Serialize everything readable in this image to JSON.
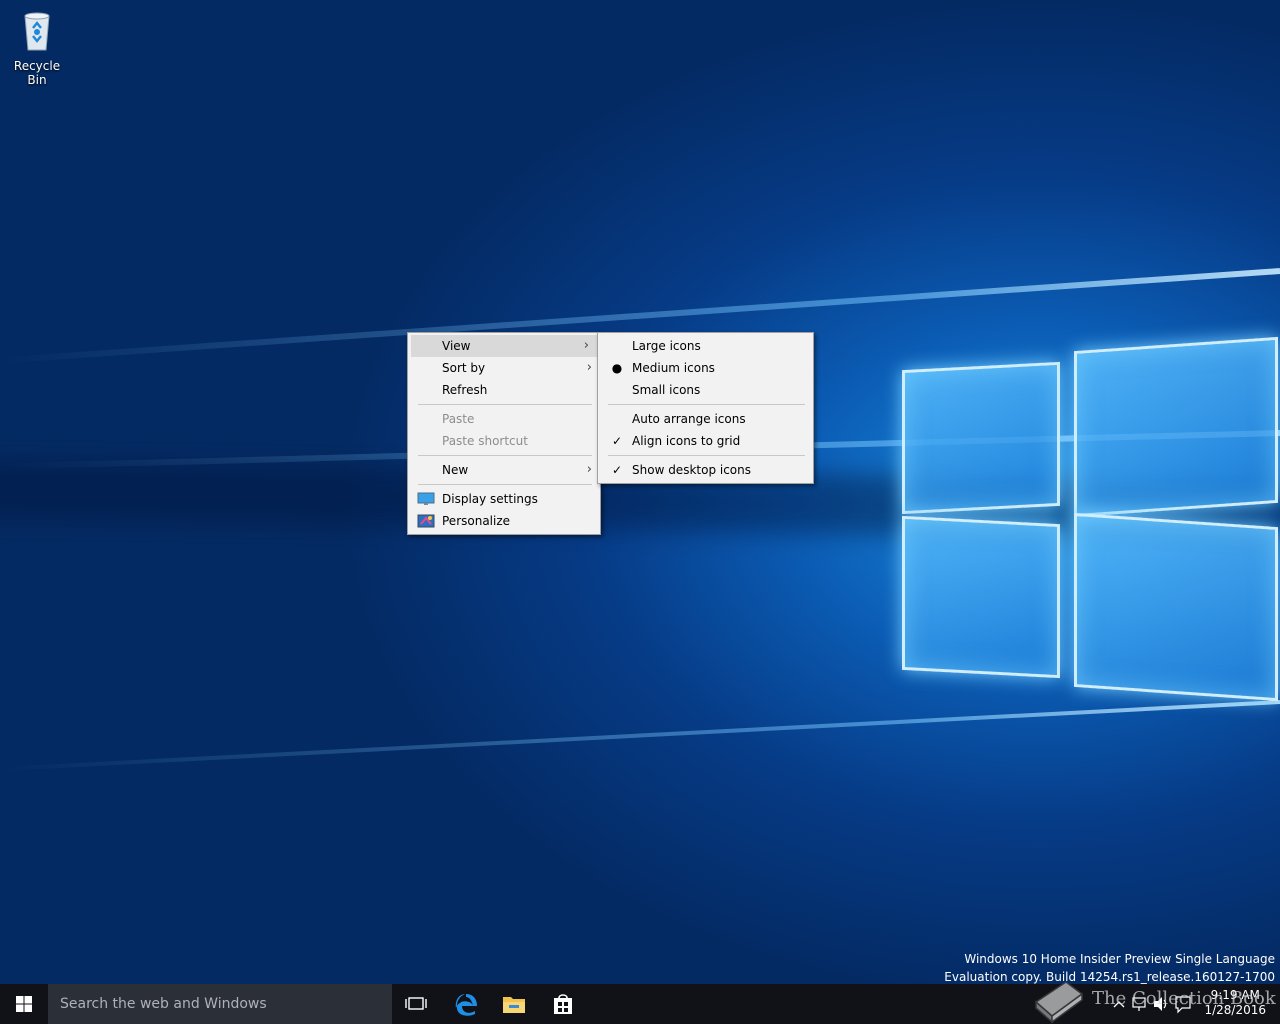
{
  "desktop": {
    "icons": [
      {
        "label": "Recycle Bin",
        "icon": "recycle-bin-icon"
      }
    ],
    "wallpaper": "Windows 10 light window hero",
    "watermark": {
      "line1": "Windows 10 Home Insider Preview Single Language",
      "line2": "Evaluation copy. Build 14254.rs1_release.160127-1700"
    }
  },
  "context_menu": {
    "view": "View",
    "sort_by": "Sort by",
    "refresh": "Refresh",
    "paste": "Paste",
    "paste_shortcut": "Paste shortcut",
    "new": "New",
    "display_settings": "Display settings",
    "personalize": "Personalize",
    "highlighted": "View"
  },
  "view_submenu": {
    "large_icons": "Large icons",
    "medium_icons": "Medium icons",
    "small_icons": "Small icons",
    "auto_arrange": "Auto arrange icons",
    "align_to_grid": "Align icons to grid",
    "show_desktop_icons": "Show desktop icons",
    "selected_size": "Medium icons",
    "checked": [
      "Align icons to grid",
      "Show desktop icons"
    ]
  },
  "taskbar": {
    "search_placeholder": "Search the web and Windows",
    "pinned": [
      "task-view-icon",
      "edge-icon",
      "file-explorer-icon",
      "store-icon"
    ],
    "time": "9:19 AM",
    "date": "1/28/2016",
    "brand_overlay": "The Collection Book"
  },
  "colors": {
    "accent": "#0b5cb4",
    "taskbar": "#101218",
    "menu_bg": "#f2f2f2",
    "menu_highlight": "#d9d9d9"
  }
}
